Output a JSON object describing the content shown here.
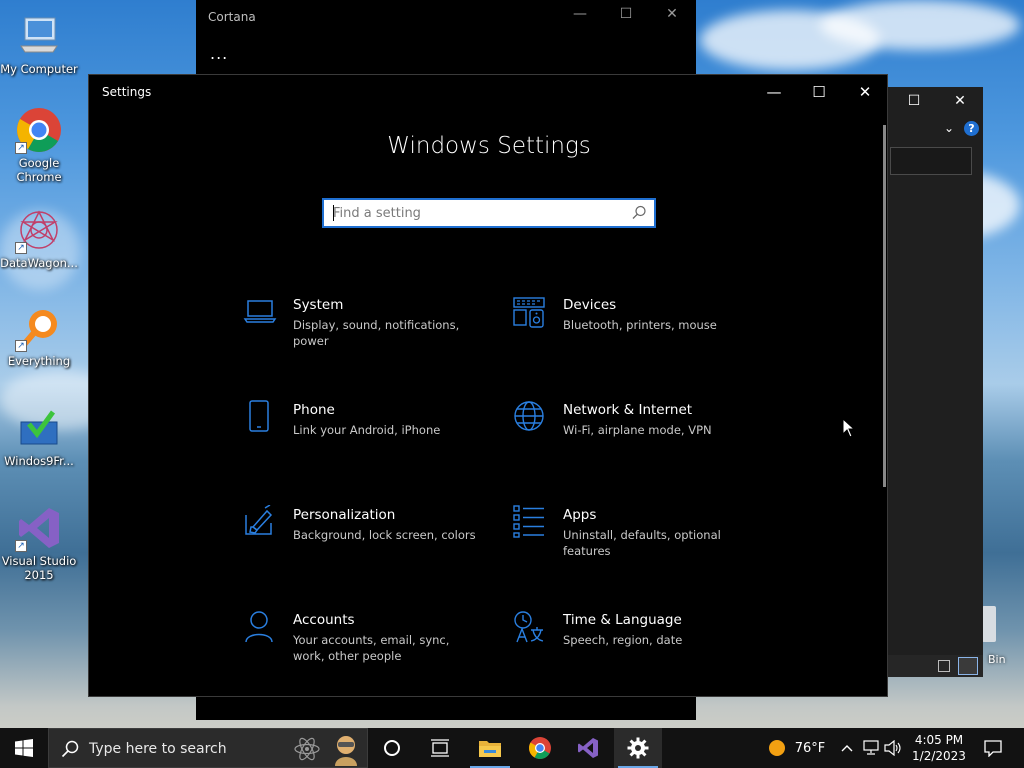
{
  "desktop": {
    "icons": [
      {
        "label": "My Computer"
      },
      {
        "label": "Google Chrome"
      },
      {
        "label": "DataWagon..."
      },
      {
        "label": "Everything"
      },
      {
        "label": "Windos9Fr..."
      },
      {
        "label": "Visual Studio 2015"
      }
    ],
    "recycle_label": "Bin"
  },
  "cortana": {
    "title": "Cortana",
    "more": "..."
  },
  "settings": {
    "window_title": "Settings",
    "heading": "Windows Settings",
    "search_placeholder": "Find a setting",
    "tiles": [
      {
        "name": "System",
        "desc": "Display, sound, notifications, power",
        "icon": "laptop-icon"
      },
      {
        "name": "Devices",
        "desc": "Bluetooth, printers, mouse",
        "icon": "devices-icon"
      },
      {
        "name": "Phone",
        "desc": "Link your Android, iPhone",
        "icon": "phone-icon"
      },
      {
        "name": "Network & Internet",
        "desc": "Wi-Fi, airplane mode, VPN",
        "icon": "globe-icon"
      },
      {
        "name": "Personalization",
        "desc": "Background, lock screen, colors",
        "icon": "paint-icon"
      },
      {
        "name": "Apps",
        "desc": "Uninstall, defaults, optional features",
        "icon": "apps-list-icon"
      },
      {
        "name": "Accounts",
        "desc": "Your accounts, email, sync, work, other people",
        "icon": "person-icon"
      },
      {
        "name": "Time & Language",
        "desc": "Speech, region, date",
        "icon": "time-language-icon"
      }
    ],
    "accent": "#1f6fd1",
    "icon_color": "#2a7fe0"
  },
  "taskbar": {
    "search_text": "Type here to search",
    "weather": "76°F",
    "time": "4:05 PM",
    "date": "1/2/2023"
  }
}
